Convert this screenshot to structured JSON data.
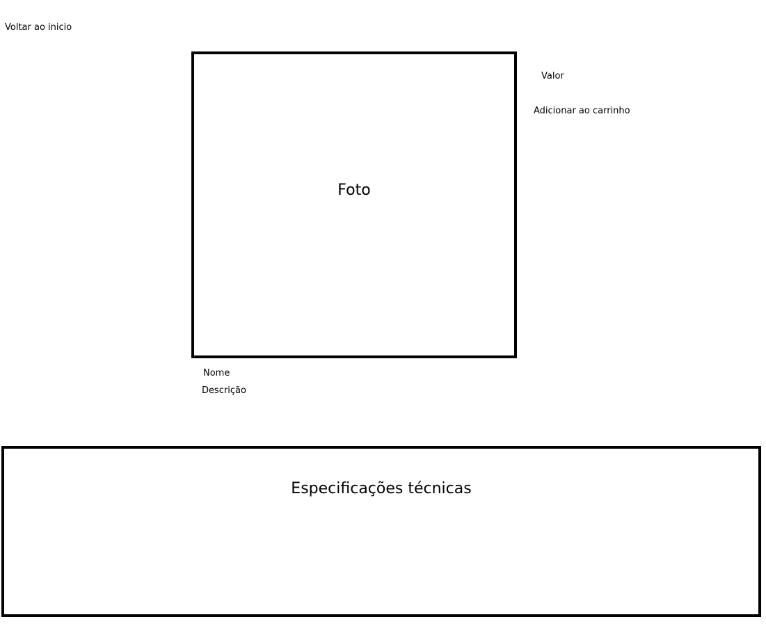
{
  "nav": {
    "back_label": "Voltar ao inicio"
  },
  "product": {
    "photo_label": "Foto",
    "price_label": "Valor",
    "add_to_cart_label": "Adicionar ao carrinho",
    "name_label": "Nome",
    "description_label": "Descrição"
  },
  "specs": {
    "title": "Especificações técnicas"
  }
}
